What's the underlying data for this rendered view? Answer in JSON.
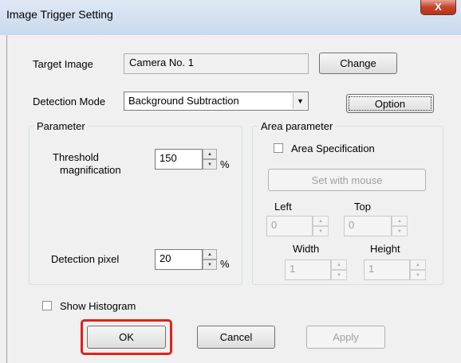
{
  "window": {
    "title": "Image Trigger Setting",
    "close_label": "X"
  },
  "target_image": {
    "label": "Target Image",
    "value": "Camera No. 1",
    "change_label": "Change"
  },
  "detection_mode": {
    "label": "Detection Mode",
    "selected": "Background Subtraction",
    "option_label": "Option"
  },
  "parameter": {
    "group_label": "Parameter",
    "threshold_label_1": "Threshold",
    "threshold_label_2": "magnification",
    "threshold_value": "150",
    "threshold_unit": "%",
    "pixel_label": "Detection pixel",
    "pixel_value": "20",
    "pixel_unit": "%"
  },
  "area": {
    "group_label": "Area parameter",
    "spec_label": "Area Specification",
    "set_mouse_label": "Set with mouse",
    "left_label": "Left",
    "left_value": "0",
    "top_label": "Top",
    "top_value": "0",
    "width_label": "Width",
    "width_value": "1",
    "height_label": "Height",
    "height_value": "1"
  },
  "histogram": {
    "label": "Show Histogram"
  },
  "buttons": {
    "ok": "OK",
    "cancel": "Cancel",
    "apply": "Apply"
  }
}
